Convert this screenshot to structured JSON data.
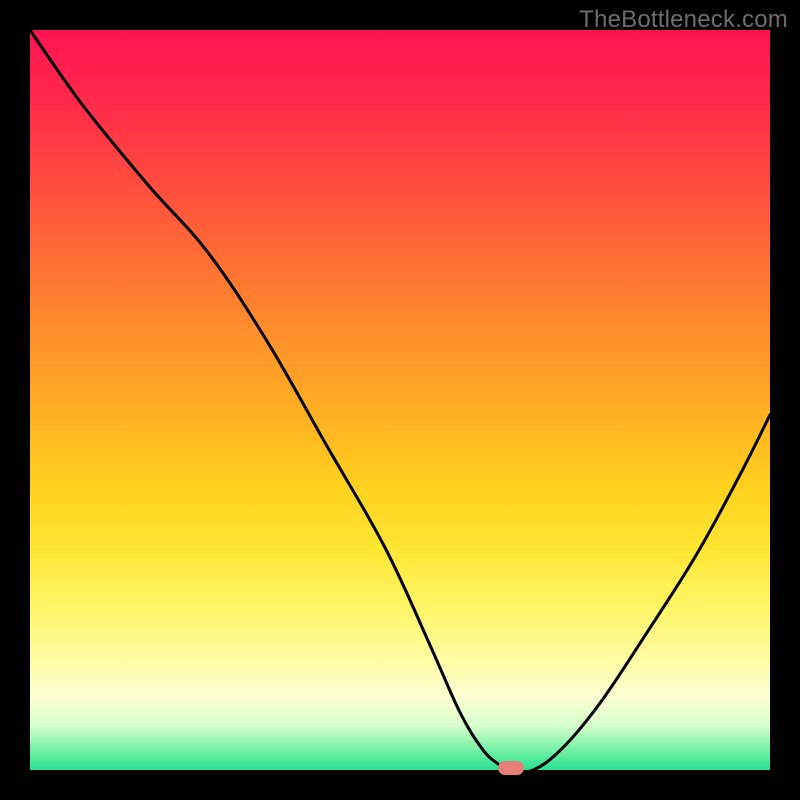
{
  "attribution": "TheBottleneck.com",
  "chart_data": {
    "type": "line",
    "title": "",
    "xlabel": "",
    "ylabel": "",
    "xlim": [
      0,
      100
    ],
    "ylim": [
      0,
      100
    ],
    "x": [
      0,
      7,
      16,
      24,
      32,
      40,
      48,
      54,
      58,
      61,
      63,
      65,
      68,
      72,
      77,
      83,
      90,
      96,
      100
    ],
    "values": [
      100,
      90,
      79,
      70,
      58,
      44,
      30,
      17,
      8,
      3,
      1,
      0,
      0,
      3,
      9,
      18,
      29,
      40,
      48
    ],
    "marker": {
      "x": 65,
      "y": 0
    },
    "gradient_heat": true
  }
}
